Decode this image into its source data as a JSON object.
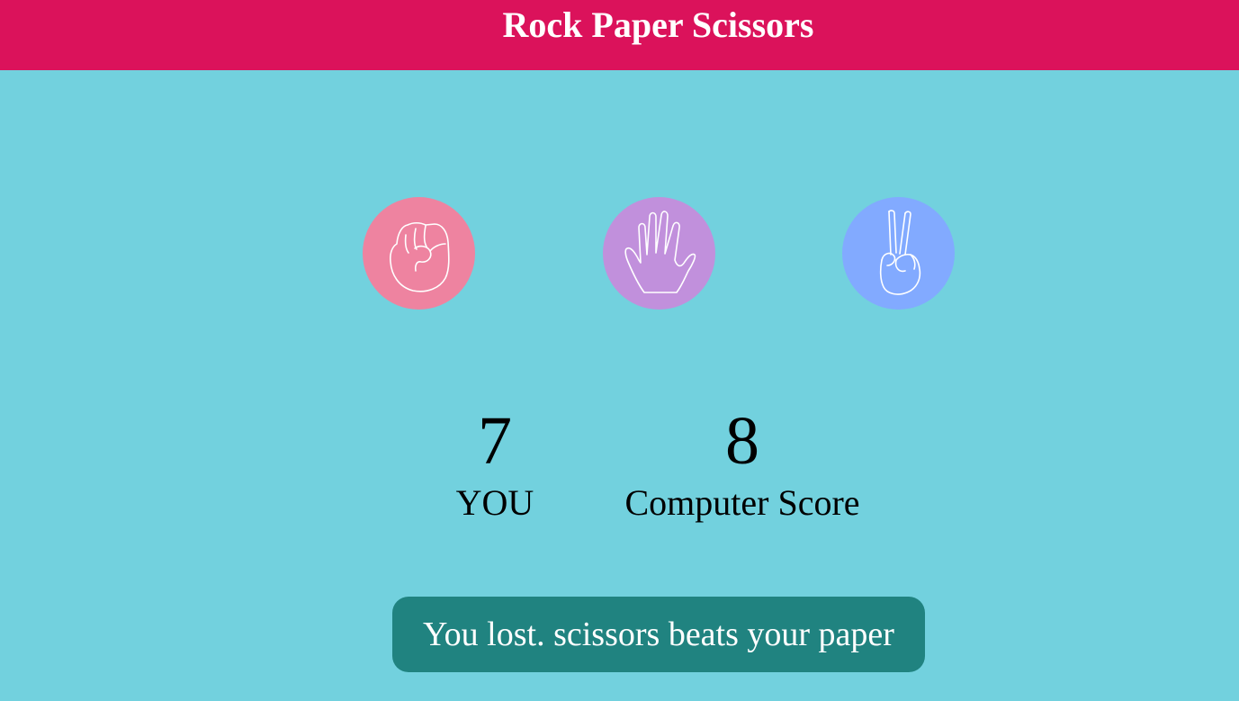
{
  "header": {
    "title": "Rock Paper Scissors",
    "background": "#db125b"
  },
  "choices": [
    {
      "name": "rock",
      "icon": "rock-hand-icon",
      "color": "#ee83a0"
    },
    {
      "name": "paper",
      "icon": "paper-hand-icon",
      "color": "#c190dc"
    },
    {
      "name": "scissors",
      "icon": "scissors-hand-icon",
      "color": "#82aaff"
    }
  ],
  "scores": {
    "user": {
      "value": "7",
      "label": "YOU"
    },
    "computer": {
      "value": "8",
      "label": "Computer Score"
    }
  },
  "result": {
    "message": "You lost. scissors beats your paper",
    "background": "#208380"
  },
  "colors": {
    "page_background": "#72d1de"
  }
}
